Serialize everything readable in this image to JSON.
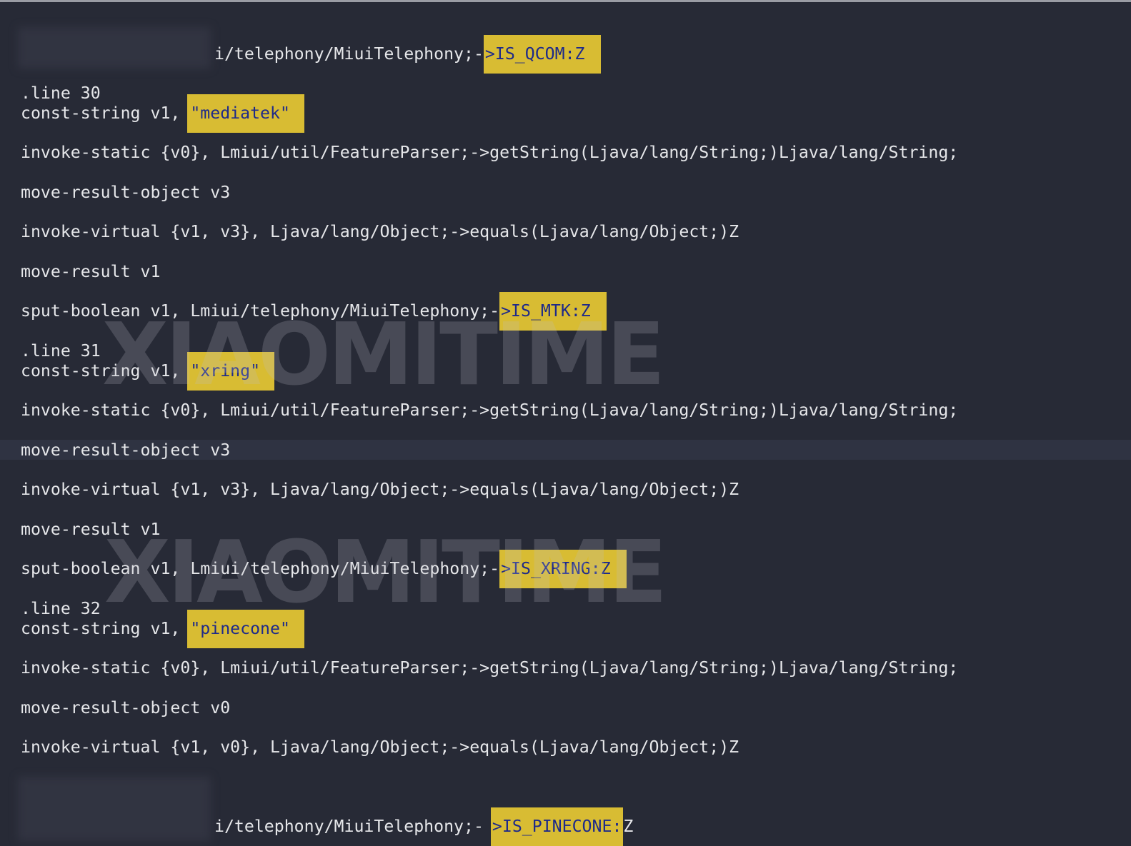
{
  "watermark": "XIAOMITIME",
  "colors": {
    "background": "#272a36",
    "text": "#e6e7ea",
    "highlight": "#d8bc33",
    "highlight_text": "#1e2a8a",
    "active_line": "#2f3342"
  },
  "lines": [
    {
      "before": "i/telephony/MiuiTelephony;-",
      "highlight": ">IS_QCOM:Z",
      "after": ""
    },
    {
      "before": ".line 30",
      "highlight": "",
      "after": ""
    },
    {
      "before": "const-string v1, ",
      "highlight": "\"mediatek\"",
      "after": ""
    },
    {
      "before": "invoke-static {v0}, Lmiui/util/FeatureParser;->getString(Ljava/lang/String;)Ljava/lang/String;",
      "highlight": "",
      "after": ""
    },
    {
      "before": "move-result-object v3",
      "highlight": "",
      "after": ""
    },
    {
      "before": "invoke-virtual {v1, v3}, Ljava/lang/Object;->equals(Ljava/lang/Object;)Z",
      "highlight": "",
      "after": ""
    },
    {
      "before": "move-result v1",
      "highlight": "",
      "after": ""
    },
    {
      "before": "sput-boolean v1, Lmiui/telephony/MiuiTelephony;-",
      "highlight": ">IS_MTK:Z",
      "after": ""
    },
    {
      "before": ".line 31",
      "highlight": "",
      "after": ""
    },
    {
      "before": "const-string v1, ",
      "highlight": "\"xring\"",
      "after": ""
    },
    {
      "before": "invoke-static {v0}, Lmiui/util/FeatureParser;->getString(Ljava/lang/String;)Ljava/lang/String;",
      "highlight": "",
      "after": ""
    },
    {
      "before": "move-result-object v3",
      "highlight": "",
      "after": ""
    },
    {
      "before": "invoke-virtual {v1, v3}, Ljava/lang/Object;->equals(Ljava/lang/Object;)Z",
      "highlight": "",
      "after": ""
    },
    {
      "before": "move-result v1",
      "highlight": "",
      "after": ""
    },
    {
      "before": "sput-boolean v1, Lmiui/telephony/MiuiTelephony;-",
      "highlight": ">IS_XRING:Z",
      "after": ""
    },
    {
      "before": ".line 32",
      "highlight": "",
      "after": ""
    },
    {
      "before": "const-string v1, ",
      "highlight": "\"pinecone\"",
      "after": ""
    },
    {
      "before": "invoke-static {v0}, Lmiui/util/FeatureParser;->getString(Ljava/lang/String;)Ljava/lang/String;",
      "highlight": "",
      "after": ""
    },
    {
      "before": "move-result-object v0",
      "highlight": "",
      "after": ""
    },
    {
      "before": "invoke-virtual {v1, v0}, Ljava/lang/Object;->equals(Ljava/lang/Object;)Z",
      "highlight": "",
      "after": ""
    },
    {
      "before": "i/telephony/MiuiTelephony;-",
      "highlight": ">IS_PINECONE:",
      "after": "Z"
    }
  ]
}
